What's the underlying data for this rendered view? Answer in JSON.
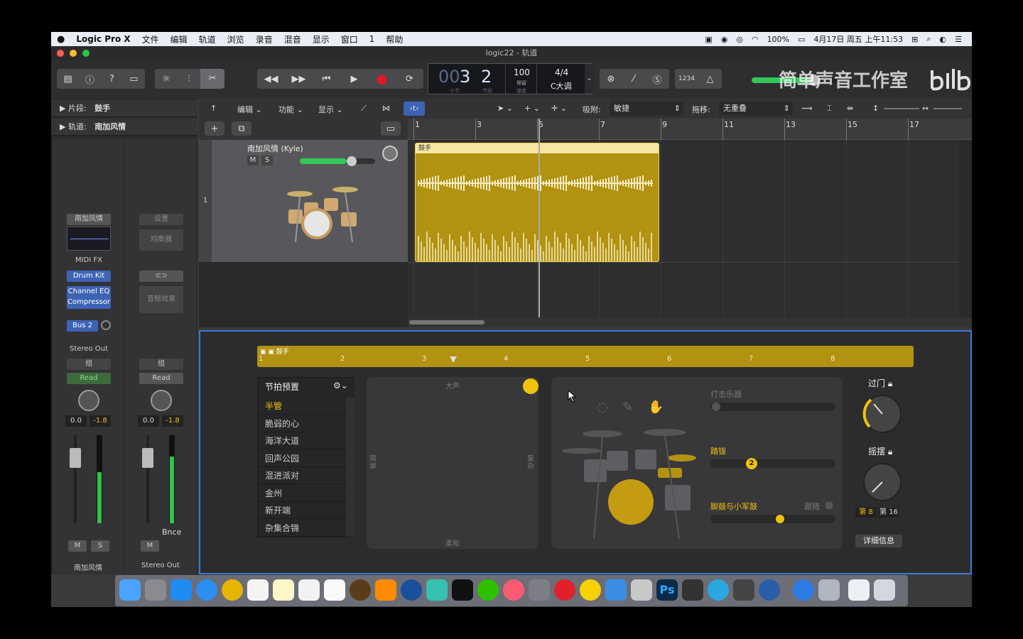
{
  "menubar": {
    "app": "Logic Pro X",
    "items": [
      "文件",
      "编辑",
      "轨道",
      "浏览",
      "录音",
      "混音",
      "显示",
      "窗口",
      "1",
      "帮助"
    ],
    "battery": "100%",
    "datetime": "4月17日 周五 上午11:53"
  },
  "window": {
    "title": "logic22 - 轨道"
  },
  "watermark": "简单声音工作室",
  "lcd": {
    "bar": "3",
    "beat": "2",
    "bar_label": "小节",
    "beat_label": "节拍",
    "tempo": "100",
    "tempo_label": "保留",
    "tempo_sub": "速度",
    "signature": "4/4",
    "key": "C大调",
    "count_in": "1234"
  },
  "inspector": {
    "region_label": "片段:",
    "region_value": "鼓手",
    "track_label": "轨道:",
    "track_value": "南加风情",
    "strip1": {
      "name_btn": "南加风情",
      "midi_fx": "MIDI FX",
      "instrument": "Drum Kit",
      "fx1": "Channel EQ",
      "fx2": "Compressor",
      "send": "Bus 2",
      "output": "Stereo Out",
      "group": "组",
      "automation": "Read",
      "vol": "0.0",
      "peak": "-1.8",
      "mute": "M",
      "solo": "S",
      "footer": "南加风情"
    },
    "strip2": {
      "settings": "设置",
      "eq": "均衡器",
      "audio_fx": "音频效果",
      "group": "组",
      "automation": "Read",
      "vol": "0.0",
      "peak": "-1.8",
      "bnce": "Bnce",
      "mute": "M",
      "footer": "Stereo Out"
    }
  },
  "track_toolbar": {
    "edit": "编辑",
    "function": "功能",
    "view": "显示",
    "snap_label": "吸附:",
    "snap_value": "敏捷",
    "drag_label": "拖移:",
    "drag_value": "无重叠"
  },
  "ruler": [
    "1",
    "3",
    "5",
    "7",
    "9",
    "11",
    "13",
    "15",
    "17"
  ],
  "track": {
    "number": "1",
    "name": "南加风情 (Kyle)",
    "mute": "M",
    "solo": "S",
    "region_name": "鼓手"
  },
  "editor": {
    "region_name": "鼓手",
    "ruler": [
      "1",
      "2",
      "3",
      "4",
      "5",
      "6",
      "7",
      "8"
    ],
    "preset_header": "节拍预置",
    "presets": [
      "半管",
      "脆弱的心",
      "海洋大道",
      "回声公园",
      "混进派对",
      "金州",
      "新开端",
      "杂集合锦"
    ],
    "selected_preset": "半管",
    "xy_top": "大声",
    "xy_bottom": "柔和",
    "xy_left": "简单",
    "xy_right": "复杂",
    "percussion": "打击乐器",
    "hihat": "踏钹",
    "hihat_value": "2",
    "kick_snare": "脚鼓与小军鼓",
    "follow": "跟随",
    "fills": "过门",
    "swing": "摇摆",
    "eighth": "第 8",
    "sixteenth": "第 16",
    "details": "详细信息"
  },
  "colors": {
    "region": "#b29211",
    "accent_yellow": "#f0c20b",
    "selection_blue": "#3a7ad6",
    "record_red": "#e5142a"
  }
}
